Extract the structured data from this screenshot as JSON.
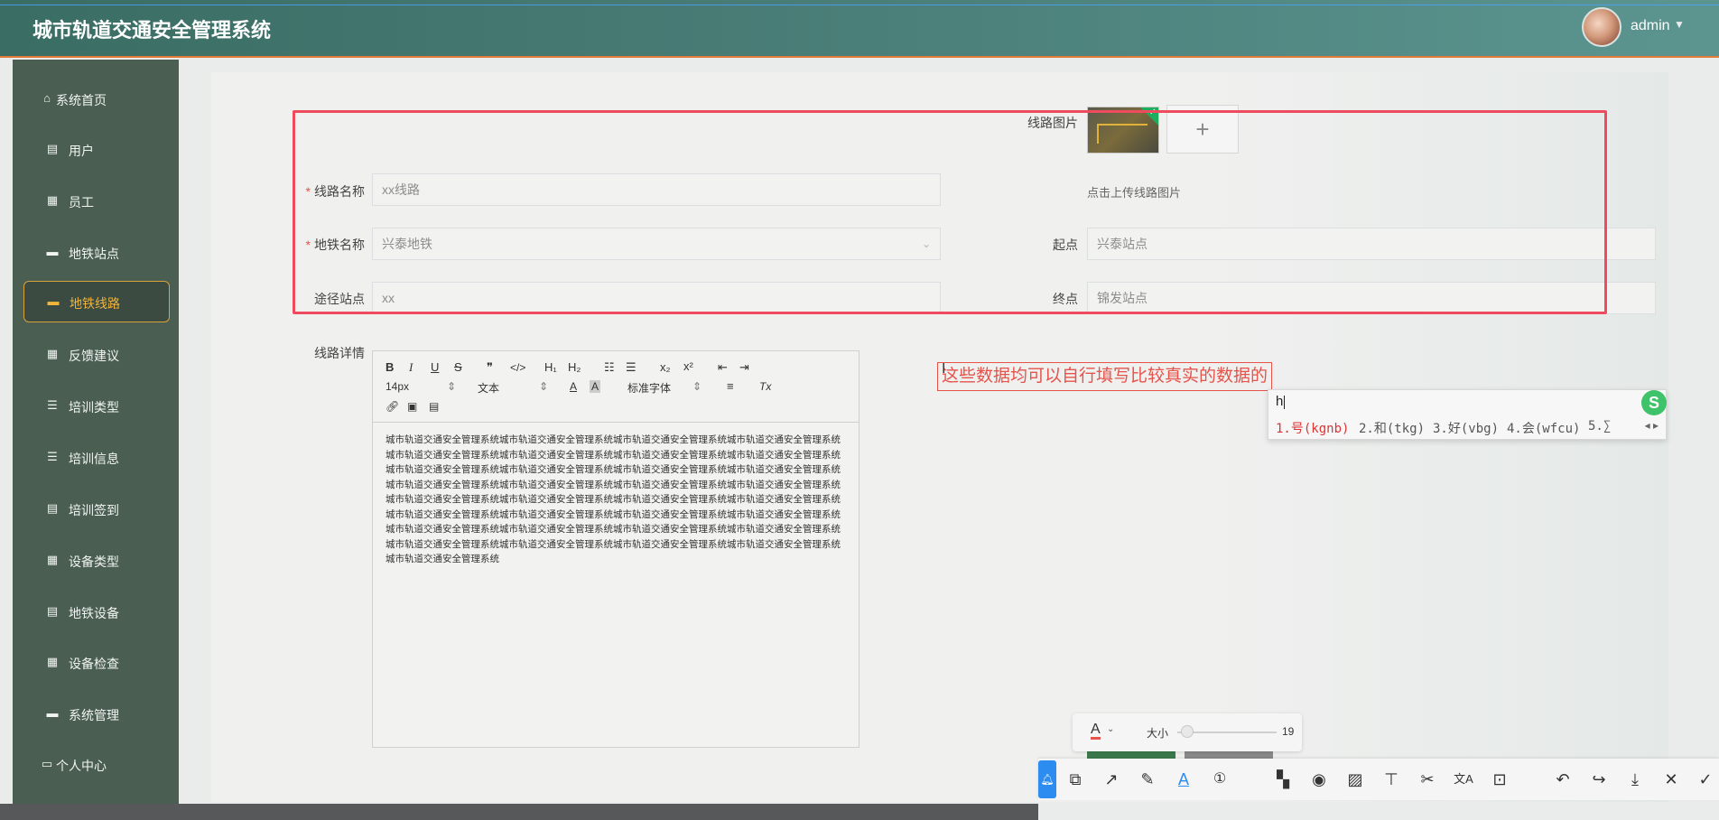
{
  "header": {
    "title": "城市轨道交通安全管理系统",
    "user": "admin",
    "caret": "▼"
  },
  "sidebar": {
    "items": [
      {
        "label": "系统首页",
        "icon": "⌂"
      },
      {
        "label": "用户",
        "icon": "▤"
      },
      {
        "label": "员工",
        "icon": "▦"
      },
      {
        "label": "地铁站点",
        "icon": "▬"
      },
      {
        "label": "地铁线路",
        "icon": "▬"
      },
      {
        "label": "反馈建议",
        "icon": "▦"
      },
      {
        "label": "培训类型",
        "icon": "☰"
      },
      {
        "label": "培训信息",
        "icon": "☰"
      },
      {
        "label": "培训签到",
        "icon": "▤"
      },
      {
        "label": "设备类型",
        "icon": "▦"
      },
      {
        "label": "地铁设备",
        "icon": "▤"
      },
      {
        "label": "设备检查",
        "icon": "▦"
      },
      {
        "label": "系统管理",
        "icon": "▬"
      },
      {
        "label": "个人中心",
        "icon": "▭"
      }
    ]
  },
  "form": {
    "req_mark": "*",
    "image_label": "线路图片",
    "upload_plus": "+",
    "upload_hint": "点击上传线路图片",
    "line_name_label": "线路名称",
    "line_name_value": "xx线路",
    "metro_name_label": "地铁名称",
    "metro_name_value": "兴泰地铁",
    "start_label": "起点",
    "start_value": "兴泰站点",
    "via_label": "途径站点",
    "via_value": "xx",
    "end_label": "终点",
    "end_value": "锦发站点",
    "detail_label": "线路详情"
  },
  "editor": {
    "toolbar": {
      "bold": "B",
      "italic": "I",
      "underline": "U",
      "strike": "S",
      "quote": "❞",
      "code": "</>",
      "h1": "H₁",
      "h2": "H₂",
      "ol": "☷",
      "ul": "☰",
      "sub": "x₂",
      "sup": "x²",
      "outdent": "⇤",
      "indent": "⇥",
      "size": "14px",
      "text": "文本",
      "font": "标准字体",
      "align": "≡",
      "clear": "Tx"
    },
    "content": "城市轨道交通安全管理系统城市轨道交通安全管理系统城市轨道交通安全管理系统城市轨道交通安全管理系统城市轨道交通安全管理系统城市轨道交通安全管理系统城市轨道交通安全管理系统城市轨道交通安全管理系统城市轨道交通安全管理系统城市轨道交通安全管理系统城市轨道交通安全管理系统城市轨道交通安全管理系统城市轨道交通安全管理系统城市轨道交通安全管理系统城市轨道交通安全管理系统城市轨道交通安全管理系统城市轨道交通安全管理系统城市轨道交通安全管理系统城市轨道交通安全管理系统城市轨道交通安全管理系统城市轨道交通安全管理系统城市轨道交通安全管理系统城市轨道交通安全管理系统城市轨道交通安全管理系统城市轨道交通安全管理系统城市轨道交通安全管理系统城市轨道交通安全管理系统城市轨道交通安全管理系统城市轨道交通安全管理系统城市轨道交通安全管理系统城市轨道交通安全管理系统城市轨道交通安全管理系统城市轨道交通安全管理系统"
  },
  "annotation": {
    "text": "这些数据均可以自行填写比较真实的数据的"
  },
  "ime": {
    "input": "h",
    "candidates": [
      "1.号(kgnb)",
      "2.和(tkg)",
      "3.好(vbg)",
      "4.会(wfcu)",
      "5.∑"
    ],
    "nav": "◂ ▸",
    "logo": "S"
  },
  "annotate_toolbar": {
    "color_glyph": "A",
    "dropdown": "⌄",
    "size_label": "大小",
    "size_value": "19",
    "size_fraction": 0.1
  }
}
